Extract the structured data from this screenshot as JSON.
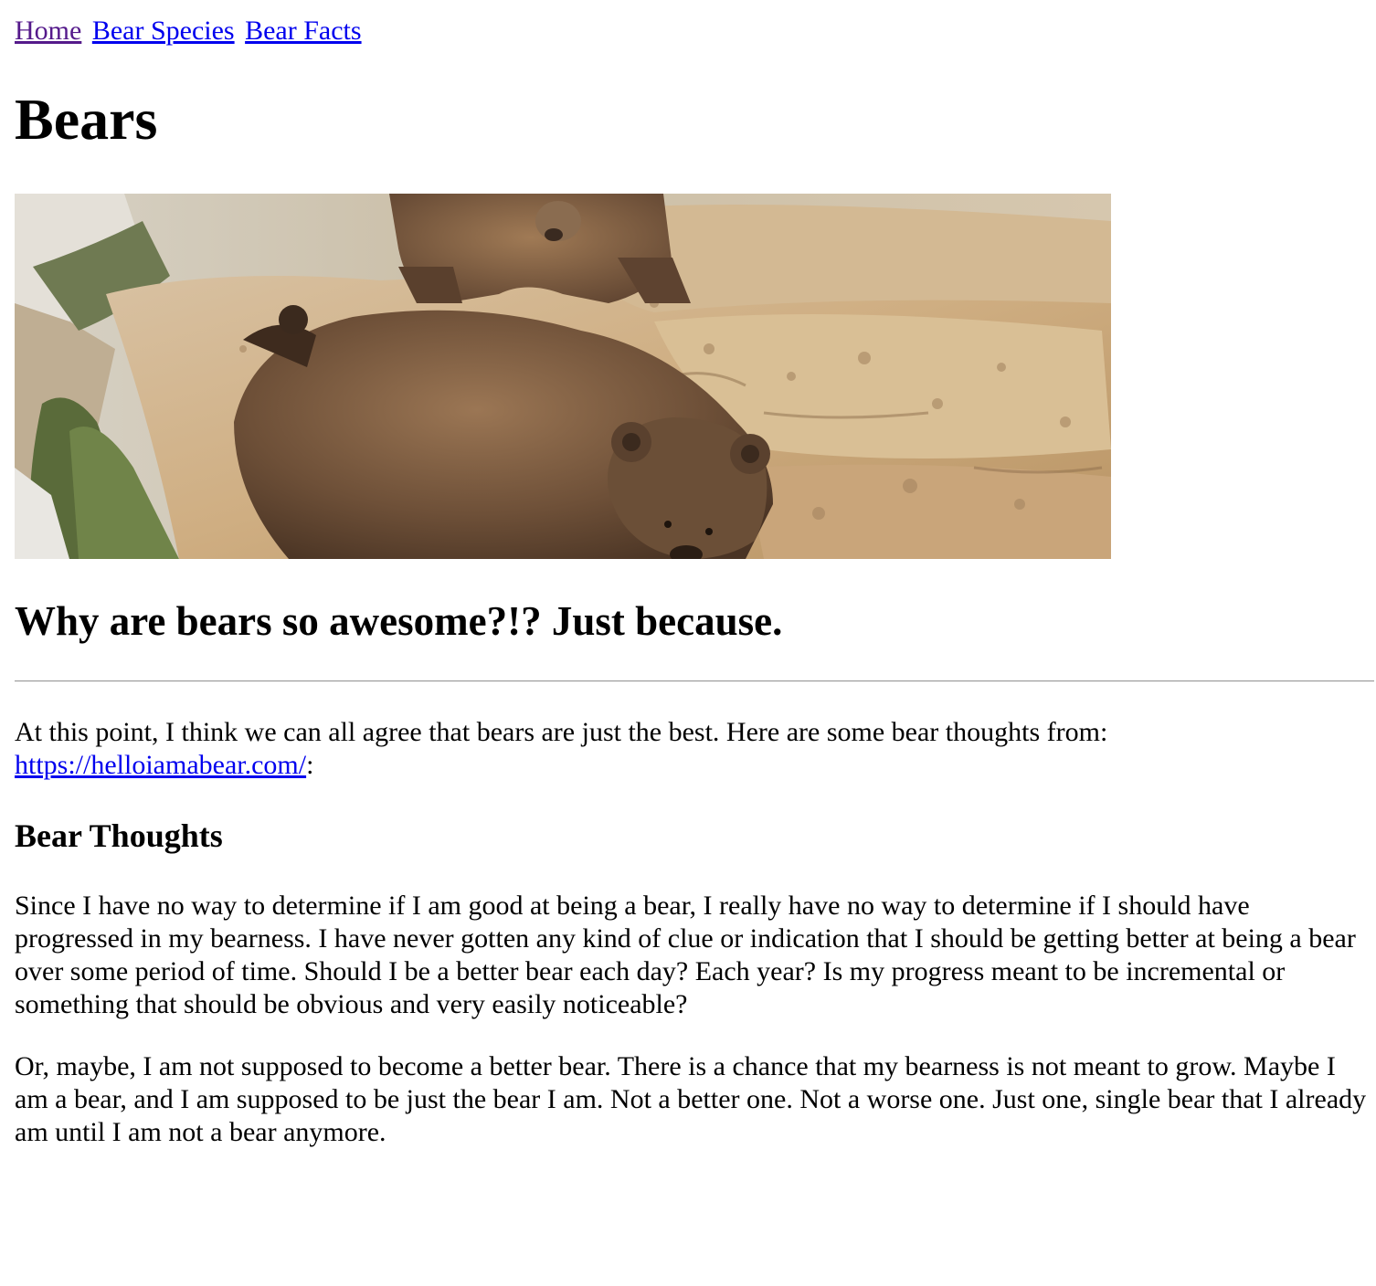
{
  "nav": {
    "links": [
      {
        "label": "Home"
      },
      {
        "label": "Bear Species"
      },
      {
        "label": "Bear Facts"
      }
    ]
  },
  "page_title": "Bears",
  "hero_image": {
    "alt": "Two brown bears on sandstone rocks"
  },
  "tagline": "Why are bears so awesome?!? Just because.",
  "intro": {
    "text": "At this point, I think we can all agree that bears are just the best. Here are some bear thoughts from:",
    "link_text": "https://helloiamabear.com/",
    "suffix": ":"
  },
  "section": {
    "heading": "Bear Thoughts",
    "paragraphs": [
      "Since I have no way to determine if I am good at being a bear, I really have no way to determine if I should have progressed in my bearness. I have never gotten any kind of clue or indication that I should be getting better at being a bear over some period of time. Should I be a better bear each day? Each year? Is my progress meant to be incremental or something that should be obvious and very easily noticeable?",
      "Or, maybe, I am not supposed to become a better bear. There is a chance that my bearness is not meant to grow. Maybe I am a bear, and I am supposed to be just the bear I am. Not a better one. Not a worse one. Just one, single bear that I already am until I am not a bear anymore."
    ]
  },
  "colors": {
    "link": "#0000ee",
    "visited_link": "#551a8b",
    "text": "#000000",
    "background": "#ffffff"
  }
}
